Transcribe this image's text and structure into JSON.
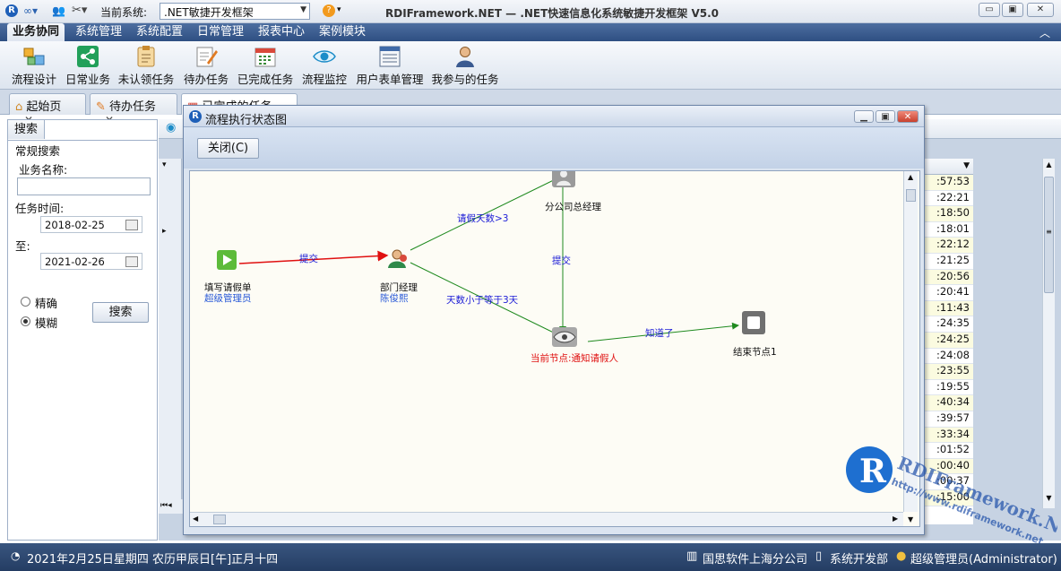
{
  "titlebar": {
    "system_label": "当前系统:",
    "system_value": ".NET敏捷开发框架",
    "app_title": "RDIFramework.NET — .NET快速信息化系统敏捷开发框架 V5.0",
    "minimize": "▭",
    "restore": "▣",
    "close": "✕"
  },
  "menu": {
    "tabs": [
      "业务协同",
      "系统管理",
      "系统配置",
      "日常管理",
      "报表中心",
      "案例模块"
    ],
    "collapse": "︿"
  },
  "ribbon": {
    "buttons": [
      "流程设计",
      "日常业务",
      "未认领任务",
      "待办任务",
      "已完成任务",
      "流程监控",
      "用户表单管理",
      "我参与的任务"
    ]
  },
  "doc_tabs": [
    "起始页",
    "待办任务",
    "已完成的任务"
  ],
  "search_panel": {
    "tab": "搜索",
    "section": "常规搜索",
    "name_label": "业务名称:",
    "name_value": "",
    "time_label": "任务时间:",
    "date_from": "2018-02-25",
    "to_label": "至:",
    "date_to": "2021-02-26",
    "radio_exact": "精确",
    "radio_fuzzy": "模糊",
    "search_button": "搜索"
  },
  "grid": {
    "times": [
      ":57:53",
      ":22:21",
      ":18:50",
      ":18:01",
      ":22:12",
      ":21:25",
      ":20:56",
      ":20:41",
      ":11:43",
      ":24:35",
      ":24:25",
      ":24:08",
      ":23:55",
      ":19:55",
      ":40:34",
      ":39:57",
      ":33:34",
      ":01:52",
      ":00:40",
      ":00:37",
      ":15:00"
    ]
  },
  "dialog": {
    "title": "流程执行状态图",
    "close_button": "关闭(C)",
    "nodes": {
      "start": {
        "name": "填写请假单",
        "user": "超级管理员"
      },
      "dept": {
        "name": "部门经理",
        "user": "陈俊熙"
      },
      "branch": {
        "name": "分公司总经理"
      },
      "notify": {
        "name": "当前节点:通知请假人"
      },
      "end": {
        "name": "结束节点1"
      }
    },
    "edges": {
      "submit1": "提交",
      "over3": "请假天数>3",
      "under3": "天数小于等于3天",
      "submit2": "提交",
      "known": "知道了"
    }
  },
  "status": {
    "date_text": "2021年2月25日星期四 农历甲辰日[午]正月十四",
    "company": "国思软件上海分公司",
    "dept": "系统开发部",
    "user": "超级管理员(Administrator)"
  },
  "watermark": {
    "brand": "RDIFramework.NET",
    "url": "http://www.rdiframework.net"
  },
  "colors": {
    "menu_bg": "#2e4f82",
    "status_bg": "#243d63",
    "edge_active": "#e01010",
    "edge_normal": "#1f8a1f",
    "edge_label": "#1b1bd6",
    "current_node_label": "#e01010"
  }
}
